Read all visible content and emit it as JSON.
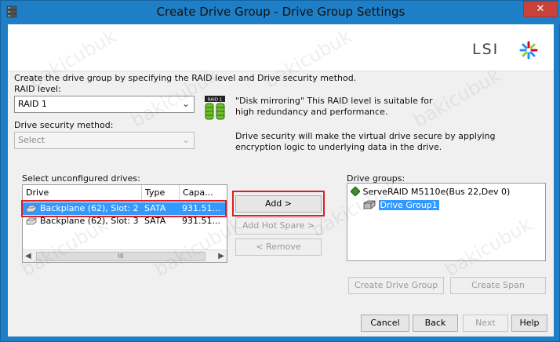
{
  "window": {
    "title": "Create Drive Group - Drive Group Settings",
    "close_label": "✕"
  },
  "brand": {
    "logo_text": "LSI"
  },
  "intro_text": "Create the drive group by specifying the RAID level and Drive security method.",
  "raid": {
    "label": "RAID level:",
    "value": "RAID 1",
    "icon_label": "RAID 1",
    "description": "\"Disk mirroring\" This RAID level is suitable for high redundancy and performance."
  },
  "security": {
    "label": "Drive security method:",
    "value": "Select",
    "description": "Drive security will make the virtual drive secure by applying encryption logic to underlying data in the drive."
  },
  "drives": {
    "label": "Select unconfigured drives:",
    "columns": [
      "Drive",
      "Type",
      "Capa..."
    ],
    "rows": [
      {
        "drive": "Backplane (62), Slot: 2",
        "type": "SATA",
        "capacity": "931.51..."
      },
      {
        "drive": "Backplane (62), Slot: 3",
        "type": "SATA",
        "capacity": "931.51..."
      }
    ],
    "scroll_thumb": "III"
  },
  "actions": {
    "add": "Add >",
    "add_hot_spare": "Add Hot Spare >",
    "remove": "< Remove"
  },
  "groups": {
    "label": "Drive groups:",
    "controller": "ServeRAID M5110e(Bus 22,Dev 0)",
    "group": "Drive Group1"
  },
  "group_buttons": {
    "create_drive_group": "Create Drive Group",
    "create_span": "Create Span"
  },
  "footer": {
    "cancel": "Cancel",
    "back": "Back",
    "next": "Next",
    "help": "Help"
  },
  "watermark": "bakicubuk",
  "colors": {
    "titlebar": "#1e7fc7",
    "selection": "#3399ff",
    "highlight_box": "#e01c24",
    "close": "#c8423a"
  }
}
